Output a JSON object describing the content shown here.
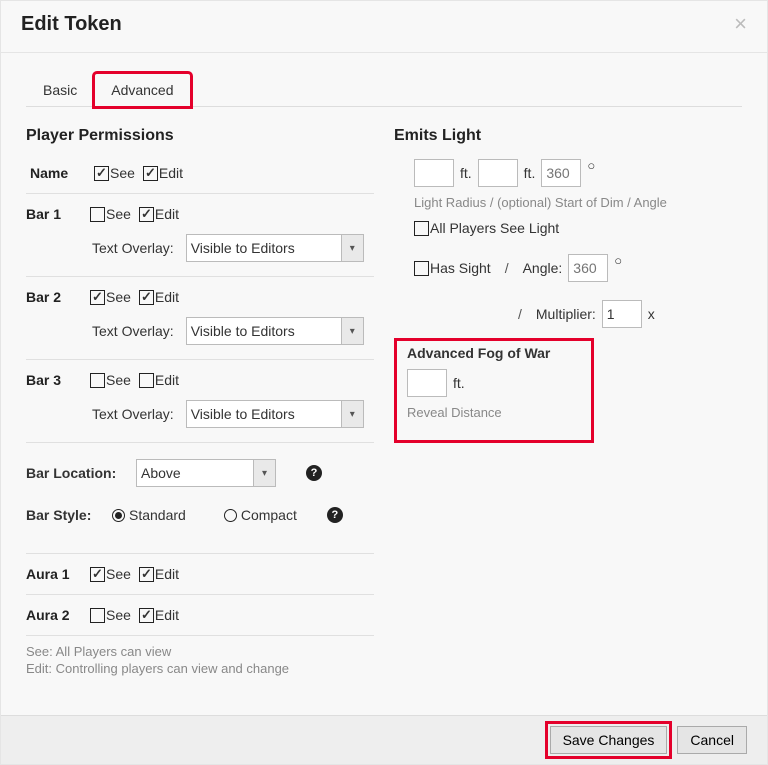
{
  "dialog": {
    "title": "Edit Token",
    "close": "×"
  },
  "tabs": {
    "basic": "Basic",
    "advanced": "Advanced"
  },
  "permissions": {
    "title": "Player Permissions",
    "nameLabel": "Name",
    "bar1Label": "Bar 1",
    "bar2Label": "Bar 2",
    "bar3Label": "Bar 3",
    "seeLabel": "See",
    "editLabel": "Edit",
    "textOverlayLabel": "Text Overlay:",
    "overlayValue": "Visible to Editors",
    "barLocationLabel": "Bar Location:",
    "barLocationValue": "Above",
    "barStyleLabel": "Bar Style:",
    "styleStandard": "Standard",
    "styleCompact": "Compact",
    "aura1Label": "Aura 1",
    "aura2Label": "Aura 2",
    "noteSee": "See: All Players can view",
    "noteEdit": "Edit: Controlling players can view and change"
  },
  "light": {
    "title": "Emits Light",
    "ft": "ft.",
    "anglePlaceholder": "360",
    "radiusCaption": "Light Radius / (optional) Start of Dim / Angle",
    "allPlayersSee": "All Players See Light",
    "hasSight": "Has Sight",
    "angleLabel": "Angle:",
    "multiplierLabel": "Multiplier:",
    "multiplierValue": "1",
    "x": "x",
    "slash": "/"
  },
  "fog": {
    "title": "Advanced Fog of War",
    "ft": "ft.",
    "caption": "Reveal Distance"
  },
  "footer": {
    "save": "Save Changes",
    "cancel": "Cancel"
  },
  "help": "?"
}
